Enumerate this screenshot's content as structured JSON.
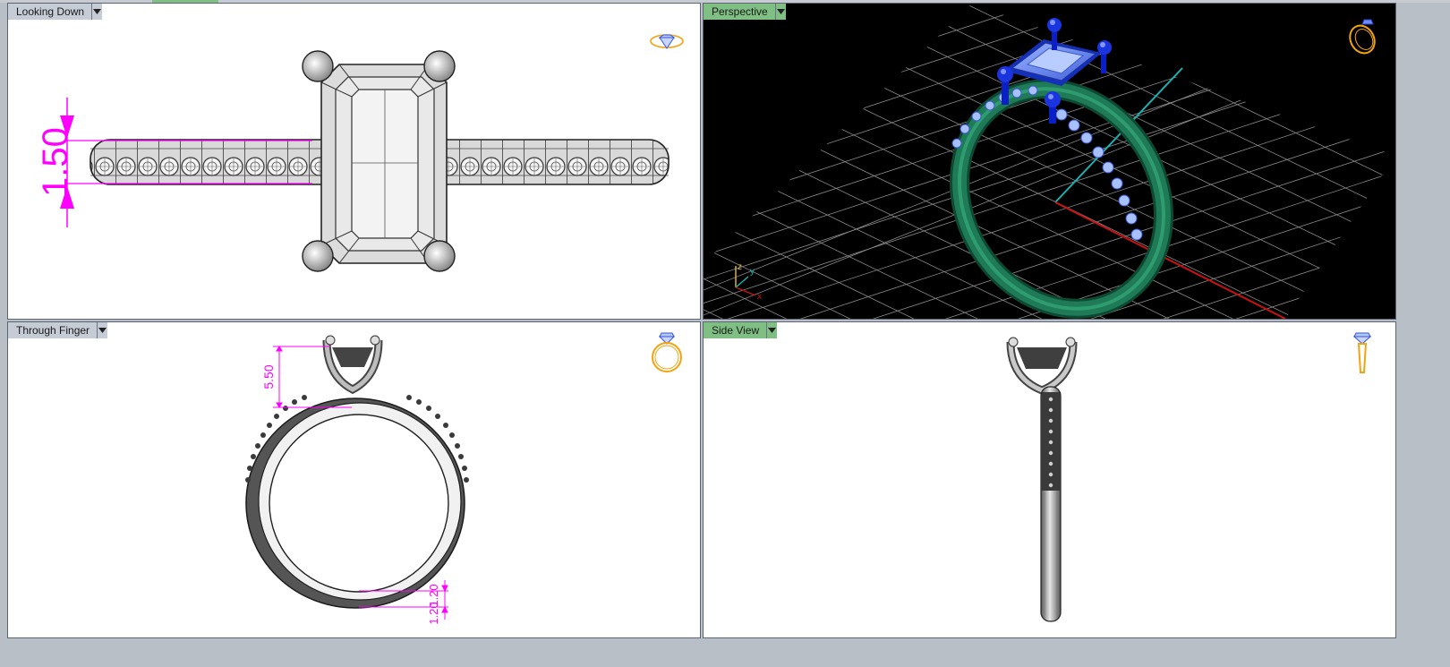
{
  "colors": {
    "frame": "#b9bfc7",
    "label_gray": "#c6ccd6",
    "label_green": "#7fbf83",
    "dimension": "#ff00ff",
    "ring_green": "#1f7a57",
    "gem_blue": "#5b7ce6",
    "prong_blue": "#0a1fc8",
    "axis_red": "#cc1010",
    "axis_cyan": "#1ab3b3",
    "icon_orange": "#f2a310"
  },
  "viewports": {
    "top_left": {
      "title": "Looking Down",
      "dimension": "1.50",
      "nav_icon": "diamond-ring-icon"
    },
    "top_right": {
      "title": "Perspective",
      "axis_z": "z",
      "axis_y": "y",
      "axis_x": "x",
      "nav_icon": "ring-perspective-icon"
    },
    "bottom_left": {
      "title": "Through Finger",
      "dimension_top": "5.50",
      "dimension_bottom_a": "1.20",
      "dimension_bottom_b": "1.20",
      "nav_icon": "ring-front-icon"
    },
    "bottom_right": {
      "title": "Side View",
      "nav_icon": "ring-side-icon"
    }
  }
}
